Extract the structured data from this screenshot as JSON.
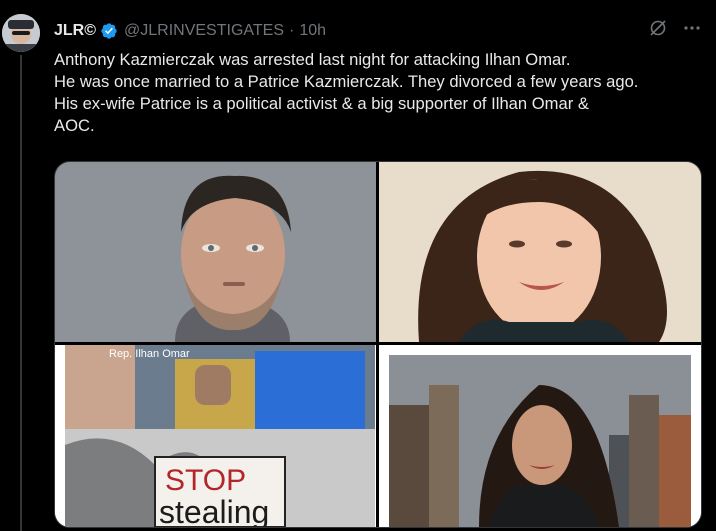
{
  "tweet": {
    "author_name": "JLR©",
    "handle": "@JLRINVESTIGATES",
    "separator": "·",
    "time_ago": "10h",
    "text_lines": [
      "Anthony Kazmierczak was arrested last night for attacking Ilhan Omar.",
      "He was once married to a Patrice Kazmierczak. They divorced a few years ago.",
      "His ex-wife Patrice is a political activist & a big supporter of Ilhan Omar &",
      "AOC."
    ],
    "icons": {
      "verified": "verified-badge-icon",
      "grok": "grok-icon",
      "more": "more-options-icon"
    }
  },
  "media": {
    "image3_overlay_label": "Rep. Ilhan Omar",
    "image3_sign_text_line1": "STOP",
    "image3_sign_text_line2": "stealing"
  },
  "colors": {
    "background": "#000000",
    "text": "#e7e9ea",
    "muted": "#71767b",
    "verified_blue": "#1d9bf0",
    "border": "#333639"
  }
}
